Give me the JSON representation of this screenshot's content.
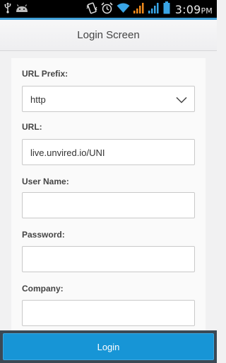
{
  "status_bar": {
    "time": "3:09",
    "time_suffix": "PM",
    "icons": [
      "usb-icon",
      "android-icon",
      "vibrate-icon",
      "alarm-icon",
      "wifi-icon",
      "signal-icon",
      "signal-icon",
      "battery-icon"
    ]
  },
  "header": {
    "title": "Login Screen"
  },
  "form": {
    "url_prefix": {
      "label": "URL Prefix:",
      "value": "http"
    },
    "url": {
      "label": "URL:",
      "value": "live.unvired.io/UNI"
    },
    "user_name": {
      "label": "User Name:",
      "value": ""
    },
    "password": {
      "label": "Password:",
      "value": ""
    },
    "company": {
      "label": "Company:",
      "value": ""
    }
  },
  "footer": {
    "login_label": "Login"
  },
  "colors": {
    "accent": "#1795d6",
    "header_line": "#3e9ed7",
    "status_orange": "#f08a1c",
    "status_blue": "#39a5e6"
  }
}
